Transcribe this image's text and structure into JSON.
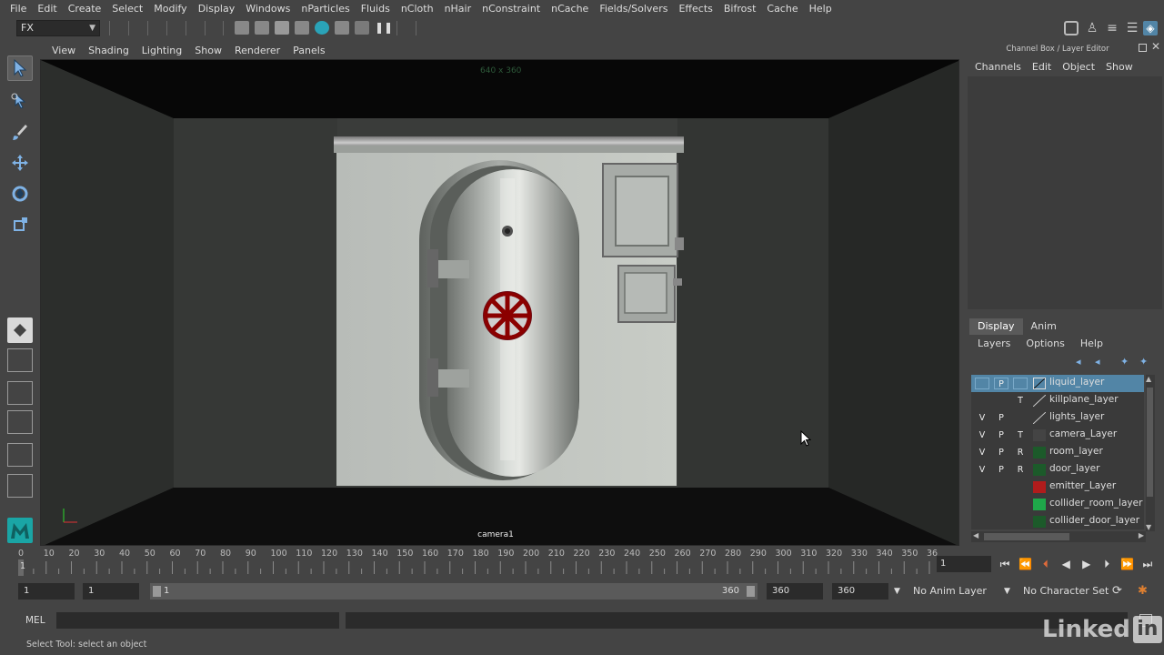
{
  "menubar": [
    "File",
    "Edit",
    "Create",
    "Select",
    "Modify",
    "Display",
    "Windows",
    "nParticles",
    "Fluids",
    "nCloth",
    "nHair",
    "nConstraint",
    "nCache",
    "Fields/Solvers",
    "Effects",
    "Bifrost",
    "Cache",
    "Help"
  ],
  "statusline": {
    "mode": "FX"
  },
  "panel_menu": [
    "View",
    "Shading",
    "Lighting",
    "Show",
    "Renderer",
    "Panels"
  ],
  "viewport": {
    "resolution": "640 x 360",
    "camera": "camera1"
  },
  "channel_box": {
    "title": "Channel Box / Layer Editor",
    "menu": [
      "Channels",
      "Edit",
      "Object",
      "Show"
    ]
  },
  "layer_editor": {
    "tabs": [
      "Display",
      "Anim"
    ],
    "active_tab": "Display",
    "menu": [
      "Layers",
      "Options",
      "Help"
    ],
    "layers": [
      {
        "v": "",
        "p": "P",
        "t": "",
        "name": "liquid_layer",
        "color": "#5285a6",
        "selected": true
      },
      {
        "v": "",
        "p": "",
        "t": "T",
        "name": "killplane_layer",
        "color": "",
        "selected": false
      },
      {
        "v": "V",
        "p": "P",
        "t": "",
        "name": "lights_layer",
        "color": "",
        "selected": false
      },
      {
        "v": "V",
        "p": "P",
        "t": "T",
        "name": "camera_Layer",
        "color": "#444444",
        "selected": false
      },
      {
        "v": "V",
        "p": "P",
        "t": "R",
        "name": "room_layer",
        "color": "#1c5a2a",
        "selected": false
      },
      {
        "v": "V",
        "p": "P",
        "t": "R",
        "name": "door_layer",
        "color": "#1c5a2a",
        "selected": false
      },
      {
        "v": "",
        "p": "",
        "t": "",
        "name": "emitter_Layer",
        "color": "#b01c1c",
        "selected": false
      },
      {
        "v": "",
        "p": "",
        "t": "",
        "name": "collider_room_layer",
        "color": "#1fa84a",
        "selected": false
      },
      {
        "v": "",
        "p": "",
        "t": "",
        "name": "collider_door_layer",
        "color": "#1c5a2a",
        "selected": false
      }
    ]
  },
  "timeslider": {
    "ticks": [
      "0",
      "10",
      "20",
      "30",
      "40",
      "50",
      "60",
      "70",
      "80",
      "90",
      "100",
      "110",
      "120",
      "130",
      "140",
      "150",
      "160",
      "170",
      "180",
      "190",
      "200",
      "210",
      "220",
      "230",
      "240",
      "250",
      "260",
      "270",
      "280",
      "290",
      "300",
      "310",
      "320",
      "330",
      "340",
      "350",
      "36"
    ],
    "current_frame": "1",
    "current_frame_field": "1"
  },
  "range": {
    "start_time": "1",
    "playback_start": "1",
    "slider_start": "1",
    "slider_end": "360",
    "playback_end": "360",
    "end_time": "360",
    "anim_layer": "No Anim Layer",
    "character_set": "No Character Set"
  },
  "command_line": {
    "label": "MEL"
  },
  "help_line": "Select Tool: select an object",
  "watermark": {
    "text": "Linked",
    "box": "in"
  },
  "colors": {
    "accent": "#5285a6",
    "handle": "#8b0000"
  }
}
